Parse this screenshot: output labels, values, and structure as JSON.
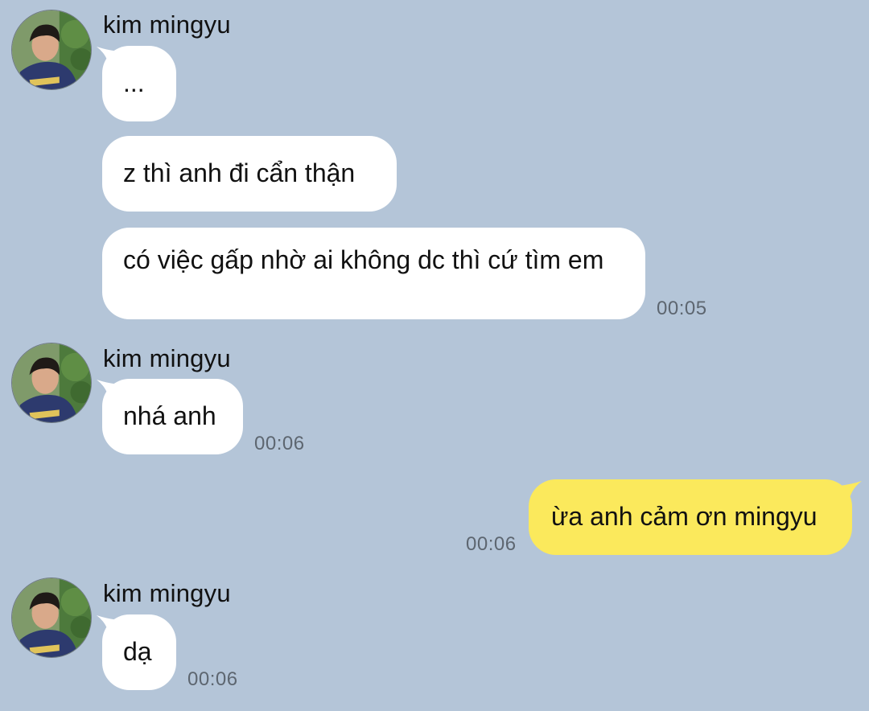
{
  "contact": {
    "name": "kim mingyu"
  },
  "messages": [
    {
      "from": "kim mingyu",
      "text": "...",
      "time": ""
    },
    {
      "from": "kim mingyu",
      "text": "z thì anh đi cẩn thận",
      "time": ""
    },
    {
      "from": "kim mingyu",
      "text": "có việc gấp nhờ ai không dc thì cứ tìm em",
      "time": "00:05"
    },
    {
      "from": "kim mingyu",
      "text": "nhá anh",
      "time": "00:06"
    },
    {
      "from": "me",
      "text": "ừa anh cảm ơn mingyu",
      "time": "00:06"
    },
    {
      "from": "kim mingyu",
      "text": "dạ",
      "time": "00:06"
    }
  ],
  "colors": {
    "background": "#b4c5d8",
    "incoming_bubble": "#ffffff",
    "outgoing_bubble": "#fbe95c",
    "timestamp": "#5d6670"
  },
  "icons": {
    "avatar": "profile-photo"
  }
}
